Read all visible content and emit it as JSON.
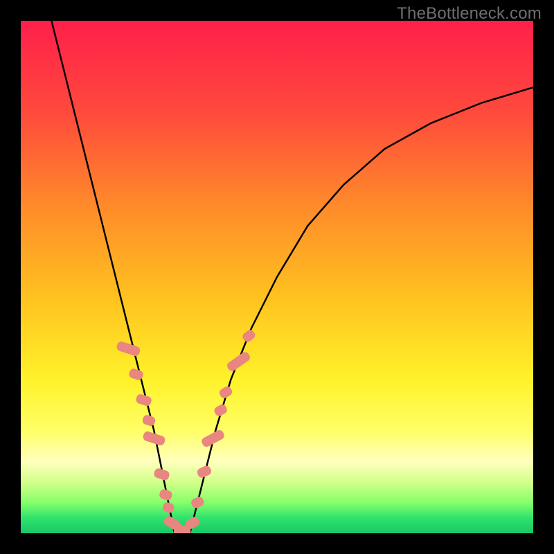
{
  "watermark": "TheBottleneck.com",
  "chart_data": {
    "type": "line",
    "title": "",
    "xlabel": "",
    "ylabel": "",
    "xlim": [
      0,
      100
    ],
    "ylim": [
      0,
      100
    ],
    "legend": false,
    "grid": false,
    "annotations": [],
    "gradient": {
      "stops": [
        {
          "pct": 0,
          "color": "#ff1f4b"
        },
        {
          "pct": 18,
          "color": "#ff4a3c"
        },
        {
          "pct": 36,
          "color": "#ff8a2a"
        },
        {
          "pct": 54,
          "color": "#ffc21f"
        },
        {
          "pct": 70,
          "color": "#fff22a"
        },
        {
          "pct": 80,
          "color": "#ffff66"
        },
        {
          "pct": 86,
          "color": "#ffffbd"
        },
        {
          "pct": 90,
          "color": "#d4ff8a"
        },
        {
          "pct": 94,
          "color": "#86ff6a"
        },
        {
          "pct": 97,
          "color": "#2fe36c"
        },
        {
          "pct": 100,
          "color": "#18c768"
        }
      ]
    },
    "series": [
      {
        "name": "left-branch",
        "color": "#000000",
        "width": 2.5,
        "x": [
          6,
          8,
          10,
          12,
          14,
          16,
          18,
          20,
          22,
          24,
          26,
          27,
          28,
          28.8,
          29.4,
          30
        ],
        "y": [
          100,
          92,
          84,
          76,
          68,
          60,
          52,
          44,
          36,
          28,
          20,
          15,
          10,
          6,
          3,
          0
        ]
      },
      {
        "name": "right-branch",
        "color": "#000000",
        "width": 2.5,
        "x": [
          33,
          34,
          35.5,
          38,
          41,
          45,
          50,
          56,
          63,
          71,
          80,
          90,
          100
        ],
        "y": [
          0,
          4,
          10,
          20,
          30,
          40,
          50,
          60,
          68,
          75,
          80,
          84,
          87
        ]
      },
      {
        "name": "valley-floor",
        "color": "#000000",
        "width": 2.5,
        "x": [
          30,
          31,
          32,
          33
        ],
        "y": [
          0,
          0,
          0,
          0
        ]
      }
    ],
    "scatter": {
      "name": "highlighted-points",
      "color": "#e8867f",
      "marker": "rounded-bar",
      "rx": 6,
      "points": [
        {
          "x": 21.0,
          "y": 36.0,
          "w": 14,
          "h": 34,
          "rot": -72
        },
        {
          "x": 22.5,
          "y": 31.0,
          "w": 14,
          "h": 20,
          "rot": -72
        },
        {
          "x": 24.0,
          "y": 26.0,
          "w": 14,
          "h": 22,
          "rot": -72
        },
        {
          "x": 25.0,
          "y": 22.0,
          "w": 14,
          "h": 18,
          "rot": -72
        },
        {
          "x": 26.0,
          "y": 18.5,
          "w": 14,
          "h": 32,
          "rot": -72
        },
        {
          "x": 27.5,
          "y": 11.5,
          "w": 14,
          "h": 22,
          "rot": -72
        },
        {
          "x": 28.3,
          "y": 7.5,
          "w": 14,
          "h": 18,
          "rot": -72
        },
        {
          "x": 28.8,
          "y": 5.0,
          "w": 14,
          "h": 16,
          "rot": -72
        },
        {
          "x": 29.5,
          "y": 2.0,
          "w": 14,
          "h": 24,
          "rot": -60
        },
        {
          "x": 30.8,
          "y": 0.3,
          "w": 14,
          "h": 22,
          "rot": 0
        },
        {
          "x": 32.2,
          "y": 0.3,
          "w": 14,
          "h": 18,
          "rot": 0
        },
        {
          "x": 33.5,
          "y": 2.0,
          "w": 14,
          "h": 20,
          "rot": 62
        },
        {
          "x": 34.5,
          "y": 6.0,
          "w": 14,
          "h": 18,
          "rot": 65
        },
        {
          "x": 35.8,
          "y": 12.0,
          "w": 14,
          "h": 20,
          "rot": 65
        },
        {
          "x": 37.5,
          "y": 18.5,
          "w": 14,
          "h": 34,
          "rot": 62
        },
        {
          "x": 39.0,
          "y": 24.0,
          "w": 14,
          "h": 18,
          "rot": 60
        },
        {
          "x": 40.0,
          "y": 27.5,
          "w": 14,
          "h": 18,
          "rot": 58
        },
        {
          "x": 42.5,
          "y": 33.5,
          "w": 14,
          "h": 36,
          "rot": 55
        },
        {
          "x": 44.5,
          "y": 38.5,
          "w": 14,
          "h": 18,
          "rot": 52
        }
      ]
    }
  }
}
